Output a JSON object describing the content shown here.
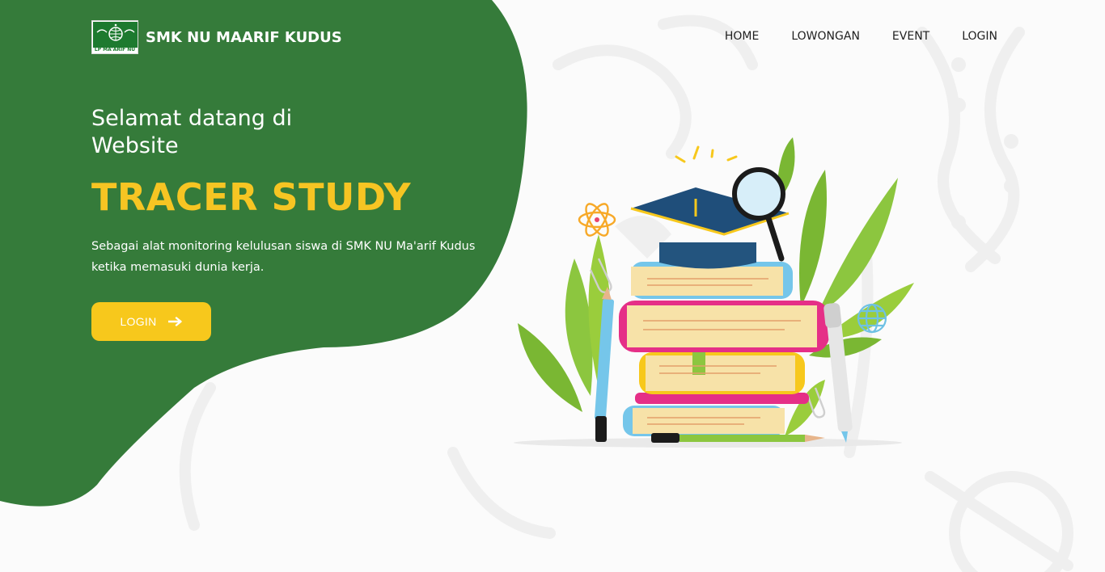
{
  "brand": {
    "name": "SMK NU MAARIF KUDUS",
    "logo_text": "LP MA'ARIF NU",
    "logo_icon": "nu-globe-emblem"
  },
  "nav": {
    "items": [
      {
        "label": "HOME"
      },
      {
        "label": "LOWONGAN"
      },
      {
        "label": "EVENT"
      },
      {
        "label": "LOGIN"
      }
    ]
  },
  "hero": {
    "welcome": "Selamat datang di Website",
    "title": "TRACER STUDY",
    "description": "Sebagai alat monitoring kelulusan siswa di SMK NU Ma'arif Kudus ketika memasuki dunia kerja.",
    "cta_label": "LOGIN",
    "cta_icon": "arrow-right-icon"
  },
  "illustration": {
    "name": "education-books-graduation-illustration"
  },
  "colors": {
    "primary_green": "#357b3a",
    "accent_yellow": "#f7c81c",
    "title_yellow": "#f6c523",
    "background": "#fbfbfb",
    "nav_text": "#1f1f1f"
  }
}
